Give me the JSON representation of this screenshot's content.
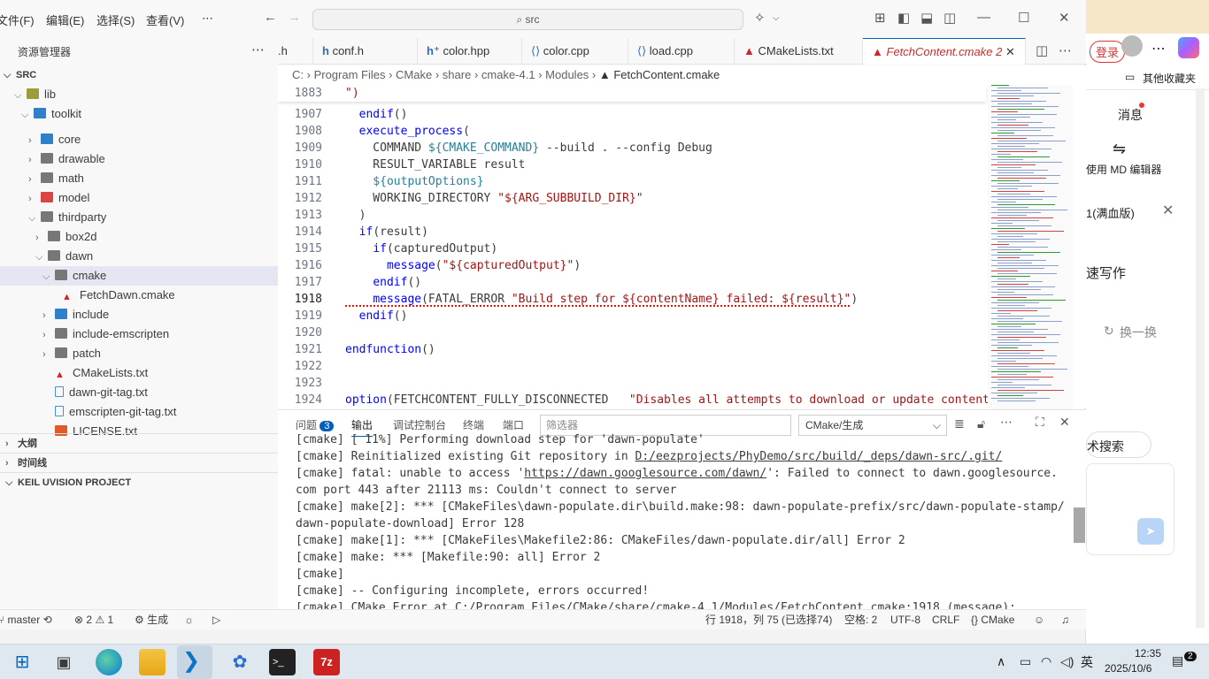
{
  "menu": [
    "文件(F)",
    "编辑(E)",
    "选择(S)",
    "查看(V)",
    "⋯"
  ],
  "search_text": "src",
  "explorer": {
    "title": "资源管理器",
    "root": "SRC",
    "tree": [
      {
        "label": "lib",
        "indent": 2,
        "type": "folder-open",
        "color": "#9c9c3a"
      },
      {
        "label": "toolkit",
        "indent": 3,
        "type": "folder-open",
        "color": "#2f80c8"
      },
      {
        "label": "core",
        "indent": 4,
        "type": "folder",
        "color": "#2f80c8"
      },
      {
        "label": "drawable",
        "indent": 4,
        "type": "folder",
        "color": "#777"
      },
      {
        "label": "math",
        "indent": 4,
        "type": "folder",
        "color": "#777"
      },
      {
        "label": "model",
        "indent": 4,
        "type": "folder",
        "color": "#d94545"
      },
      {
        "label": "thirdparty",
        "indent": 4,
        "type": "folder-open",
        "color": "#777"
      },
      {
        "label": "box2d",
        "indent": 5,
        "type": "folder",
        "color": "#777"
      },
      {
        "label": "dawn",
        "indent": 5,
        "type": "folder-open",
        "color": "#777"
      },
      {
        "label": "cmake",
        "indent": 6,
        "type": "folder-open",
        "color": "#777",
        "selected": true
      },
      {
        "label": "FetchDawn.cmake",
        "indent": 7,
        "type": "cmake"
      },
      {
        "label": "include",
        "indent": 6,
        "type": "folder",
        "color": "#2f80c8"
      },
      {
        "label": "include-emscripten",
        "indent": 6,
        "type": "folder",
        "color": "#777"
      },
      {
        "label": "patch",
        "indent": 6,
        "type": "folder",
        "color": "#777"
      },
      {
        "label": "CMakeLists.txt",
        "indent": 6,
        "type": "cmake"
      },
      {
        "label": "dawn-git-tag.txt",
        "indent": 6,
        "type": "txt"
      },
      {
        "label": "emscripten-git-tag.txt",
        "indent": 6,
        "type": "txt"
      },
      {
        "label": "LICENSE.txt",
        "indent": 6,
        "type": "lic"
      }
    ],
    "sections": [
      "大纲",
      "时间线",
      "KEIL UVISION PROJECT"
    ]
  },
  "tabs": [
    ".h",
    "conf.h",
    "color.hpp",
    "color.cpp",
    "load.cpp",
    "CMakeLists.txt",
    "FetchContent.cmake"
  ],
  "tab_badge": "2",
  "breadcrumb": [
    "C:",
    "Program Files",
    "CMake",
    "share",
    "cmake-4.1",
    "Modules",
    "FetchContent.cmake"
  ],
  "editor": {
    "sticky": {
      "num": "1883",
      "text": "\")"
    },
    "lines": [
      {
        "num": "1907",
        "html": "  <span class='k'>endif</span>()"
      },
      {
        "num": "1908",
        "html": "  <span class='k'>execute_process</span>("
      },
      {
        "num": "1909",
        "html": "    COMMAND <span class='v'>${CMAKE_COMMAND}</span> --build . --config Debug"
      },
      {
        "num": "1910",
        "html": "    RESULT_VARIABLE result"
      },
      {
        "num": "1911",
        "html": "    <span class='v'>${outputOptions}</span>"
      },
      {
        "num": "1912",
        "html": "    WORKING_DIRECTORY <span class='s'>\"${ARG_SUBBUILD_DIR}\"</span>"
      },
      {
        "num": "1913",
        "html": "  )"
      },
      {
        "num": "1914",
        "html": "  <span class='k'>if</span>(result)"
      },
      {
        "num": "1915",
        "html": "    <span class='k'>if</span>(capturedOutput)"
      },
      {
        "num": "1916",
        "html": "      <span class='k'>message</span>(<span class='s'>\"${capturedOutput}\"</span>)"
      },
      {
        "num": "1917",
        "html": "    <span class='k'>endif</span>()"
      },
      {
        "num": "1918",
        "html": "    <span class='k'>message</span>(FATAL_ERROR <span class='s'>\"Build step for ${contentName} failed: ${result}\"</span>)"
      },
      {
        "num": "1919",
        "html": "  <span class='k'>endif</span>()"
      },
      {
        "num": "1920",
        "html": ""
      },
      {
        "num": "1921",
        "html": "<span class='k'>endfunction</span>()"
      },
      {
        "num": "1922",
        "html": ""
      },
      {
        "num": "1923",
        "html": ""
      },
      {
        "num": "1924",
        "html": "<span class='k'>option</span>(FETCHCONTENT_FULLY_DISCONNECTED   <span class='s'>\"Disables all attempts to download or update content</span>"
      }
    ]
  },
  "panel": {
    "tabs": [
      "问题",
      "输出",
      "调试控制台",
      "终端",
      "端口"
    ],
    "problem_count": "3",
    "filter_placeholder": "筛选器",
    "channel": "CMake/生成",
    "output": [
      "[cmake] [ 11%] Performing download step for 'dawn-populate'",
      "[cmake] Reinitialized existing Git repository in D:/eezprojects/PhyDemo/src/build/_deps/dawn-src/.git/",
      "[cmake] fatal: unable to access 'https://dawn.googlesource.com/dawn/': Failed to connect to dawn.googlesource.",
      "com port 443 after 21113 ms: Couldn't connect to server",
      "[cmake] make[2]: *** [CMakeFiles\\dawn-populate.dir\\build.make:98: dawn-populate-prefix/src/dawn-populate-stamp/",
      "dawn-populate-download] Error 128",
      "[cmake] make[1]: *** [CMakeFiles\\Makefile2:86: CMakeFiles/dawn-populate.dir/all] Error 2",
      "[cmake] make: *** [Makefile:90: all] Error 2",
      "[cmake]",
      "[cmake] -- Configuring incomplete, errors occurred!",
      "[cmake] CMake Error at C:/Program Files/CMake/share/cmake-4.1/Modules/FetchContent.cmake:1918 (message):"
    ]
  },
  "status": {
    "branch": "master",
    "errors": "2",
    "warnings": "1",
    "build": "生成",
    "position": "行 1918，列 75 (已选择74)",
    "spaces": "空格: 2",
    "encoding": "UTF-8",
    "eol": "CRLF",
    "lang": "CMake"
  },
  "browser": {
    "login": "登录",
    "favorites": "其他收藏夹",
    "msg": "消息",
    "md": "使用 MD 编辑器",
    "ver": "1(满血版)",
    "write": "速写作",
    "switch": "换一换",
    "search": "术搜索"
  },
  "clock": {
    "time": "12:35",
    "date": "2025/10/6",
    "ime": "英",
    "notif": "2"
  }
}
